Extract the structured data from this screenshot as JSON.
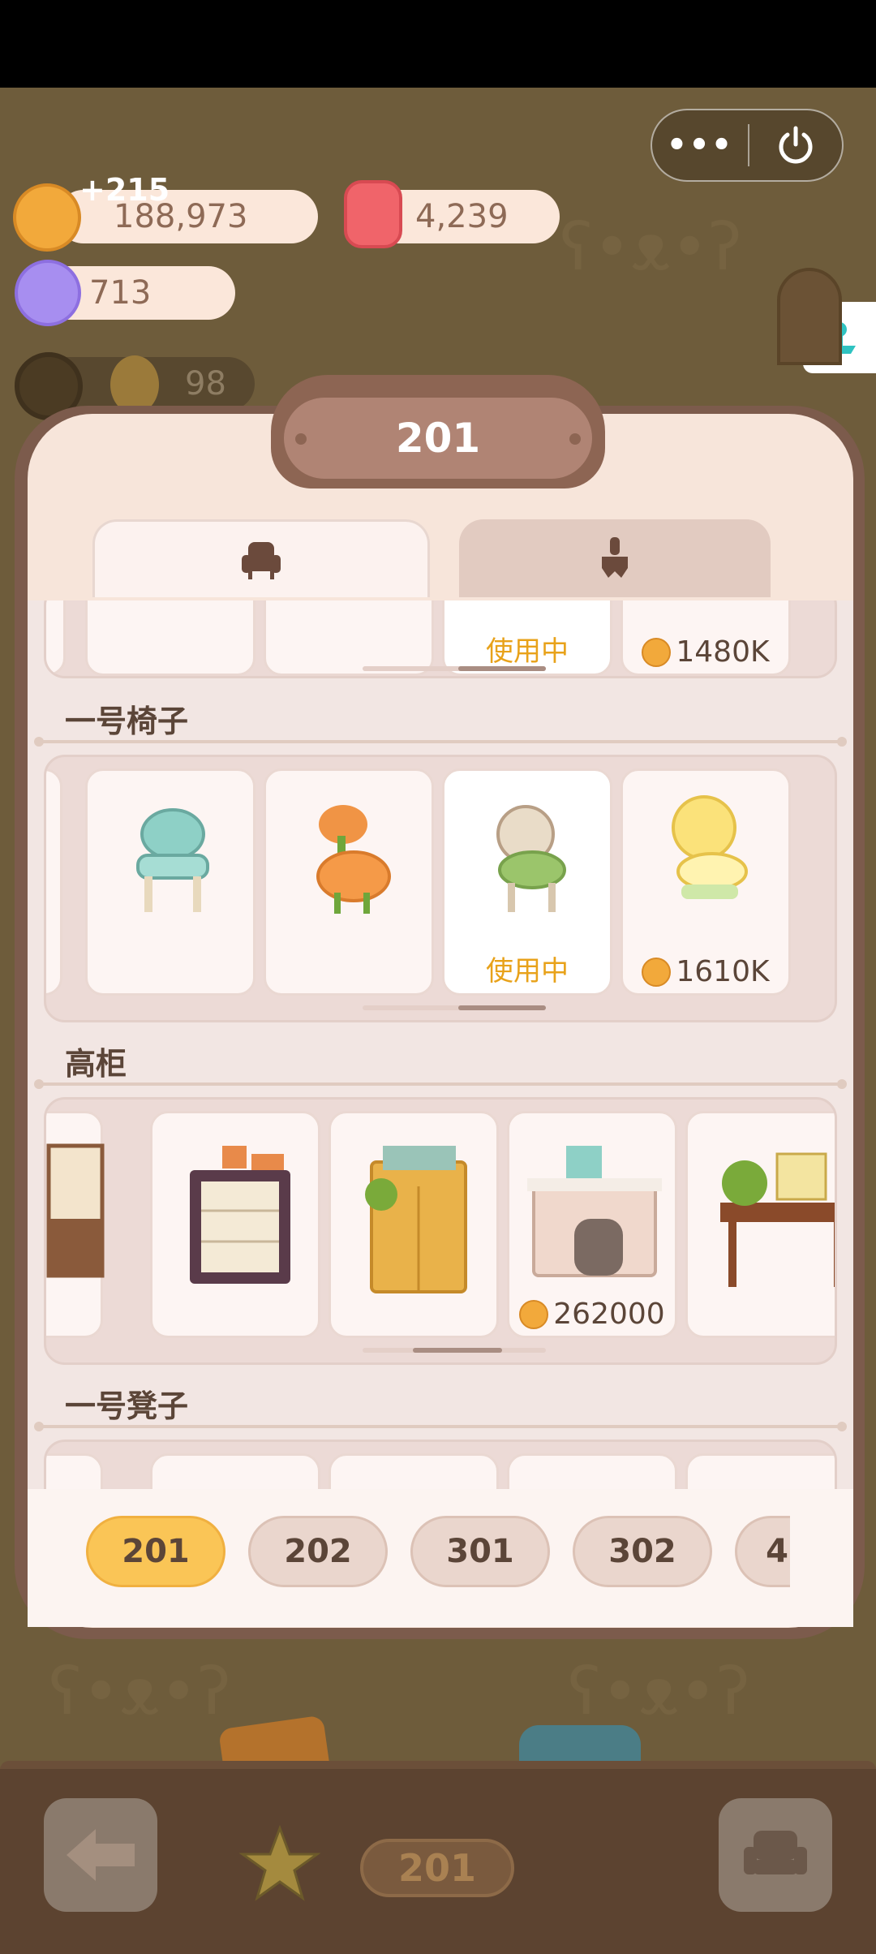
{
  "resources": {
    "cookies": {
      "value": "188,973",
      "gain": "+215"
    },
    "jam": {
      "value": "4,239"
    },
    "candy": {
      "value": "713"
    },
    "stars": {
      "value": "98"
    }
  },
  "panel": {
    "title": "201"
  },
  "tabs": [
    {
      "name": "furniture",
      "icon": "armchair-icon"
    },
    {
      "name": "decor",
      "icon": "paintbrush-icon"
    }
  ],
  "sections": [
    {
      "title": "",
      "items": [
        {
          "status": ""
        },
        {
          "status": ""
        },
        {
          "status": "使用中"
        },
        {
          "price": "1480K"
        }
      ]
    },
    {
      "title": "一号椅子",
      "items": [
        {
          "name": "mint-chair",
          "status": ""
        },
        {
          "name": "orange-chair",
          "status": ""
        },
        {
          "name": "green-cushion-chair",
          "status": "使用中"
        },
        {
          "name": "lemon-chair",
          "price": "1610K"
        }
      ]
    },
    {
      "title": "高柜",
      "items": [
        {
          "name": "bookcase",
          "status": ""
        },
        {
          "name": "purple-drawer-cabinet",
          "status": ""
        },
        {
          "name": "wooden-wardrobe",
          "status": ""
        },
        {
          "name": "fireplace",
          "price": "262000"
        },
        {
          "name": "plant-side-table",
          "status": ""
        }
      ]
    },
    {
      "title": "一号凳子",
      "items": []
    }
  ],
  "in_use_label": "使用中",
  "rooms": [
    "201",
    "202",
    "301",
    "302",
    "4"
  ],
  "dock": {
    "room_label": "201"
  },
  "colors": {
    "accent": "#fac556",
    "panel": "#f7e5da",
    "in_use": "#e8a21a"
  }
}
